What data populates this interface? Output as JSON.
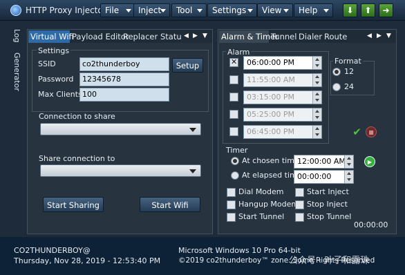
{
  "window": {
    "title": "HTTP Proxy Injector",
    "menus": [
      "File",
      "Inject",
      "Tool",
      "Settings",
      "View",
      "Help"
    ],
    "toolbar_icons": [
      "arrow-down-icon",
      "arrow-up-icon",
      "arrow-right-icon"
    ],
    "toolbar_glyphs": [
      "⬇",
      "⬆",
      "➜"
    ],
    "accent": "#2f6aa8"
  },
  "side_tabs": [
    "Log",
    "Generator"
  ],
  "left_panel": {
    "tabs": [
      "Virtual Wifi",
      "Payload Editor",
      "Replacer",
      "Statu"
    ],
    "nav_prev": "◀",
    "nav_next": "▶",
    "nav_menu": "▼",
    "settings_label": "Settings",
    "ssid_label": "SSID",
    "ssid_value": "co2thunderboy",
    "setup_label": "Setup",
    "password_label": "Password",
    "password_value": "12345678",
    "max_clients_label": "Max Clients",
    "max_clients_value": "100",
    "connection_to_share_label": "Connection to share",
    "connection_to_share_value": "",
    "share_connection_to_label": "Share connection to",
    "share_connection_to_value": "",
    "start_sharing_label": "Start Sharing",
    "start_wifi_label": "Start Wifi"
  },
  "right_panel": {
    "tabs": [
      "Alarm & Timer",
      "Tunnel",
      "Dialer",
      "Route"
    ],
    "nav_prev": "◀",
    "nav_next": "▶",
    "nav_menu": "▼",
    "alarm_label": "Alarm",
    "alarms": [
      {
        "time": "06:00:00 PM",
        "checked": true
      },
      {
        "time": "11:55:00 AM",
        "checked": false
      },
      {
        "time": "03:15:00 PM",
        "checked": false
      },
      {
        "time": "05:25:00 PM",
        "checked": false
      },
      {
        "time": "06:45:00 PM",
        "checked": false
      }
    ],
    "format_label": "Format",
    "format_options": [
      "12",
      "24"
    ],
    "format_selected": "12",
    "confirm_glyph": "✔",
    "cancel_glyph": "■",
    "timer_label": "Timer",
    "at_chosen_time_label": "At chosen time",
    "at_chosen_time_value": "12:00:00 AM",
    "at_elapsed_time_label": "At elapsed time",
    "at_elapsed_time_value": "00:00:00",
    "play_glyph": "▶",
    "actions": [
      "Dial Modem",
      "Start Inject",
      "Hangup Modem",
      "Stop Inject",
      "Start Tunnel",
      "Stop Tunnel"
    ],
    "elapsed": "00:00:00"
  },
  "status_bar": {
    "user": "CO2THUNDERBOY@",
    "datetime": "Thursday, Nov 28, 2019 - 12:53:40 PM",
    "os": "Microsoft Windows 10 Pro 64-bit",
    "copyright": "©2019 co2thunderboy™ zone. Some Rights Reserved",
    "watermark": "公众号 · 叶子和露珠"
  }
}
